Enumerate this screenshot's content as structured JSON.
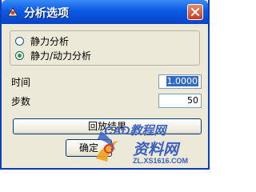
{
  "window": {
    "title": "分析选项",
    "icons": {
      "app": "analysis-app-icon",
      "close": "close-icon"
    }
  },
  "analysis_type": {
    "options": [
      {
        "label": "静力分析",
        "selected": false
      },
      {
        "label": "静力/动力分析",
        "selected": true
      }
    ]
  },
  "fields": {
    "time": {
      "label": "时间",
      "value": "1.0000"
    },
    "steps": {
      "label": "步数",
      "value": "50"
    }
  },
  "buttons": {
    "playback": "回放结果",
    "ok": "确定"
  },
  "watermark": {
    "site_top": "CAD教程网",
    "site_brand": "资料网",
    "site_url": "ZL.XS1616.COM"
  },
  "colors": {
    "title_bar": "#0a5be4",
    "dialog_bg": "#ece9d8",
    "selection": "#316ac5",
    "radio_dot": "#21a121"
  }
}
